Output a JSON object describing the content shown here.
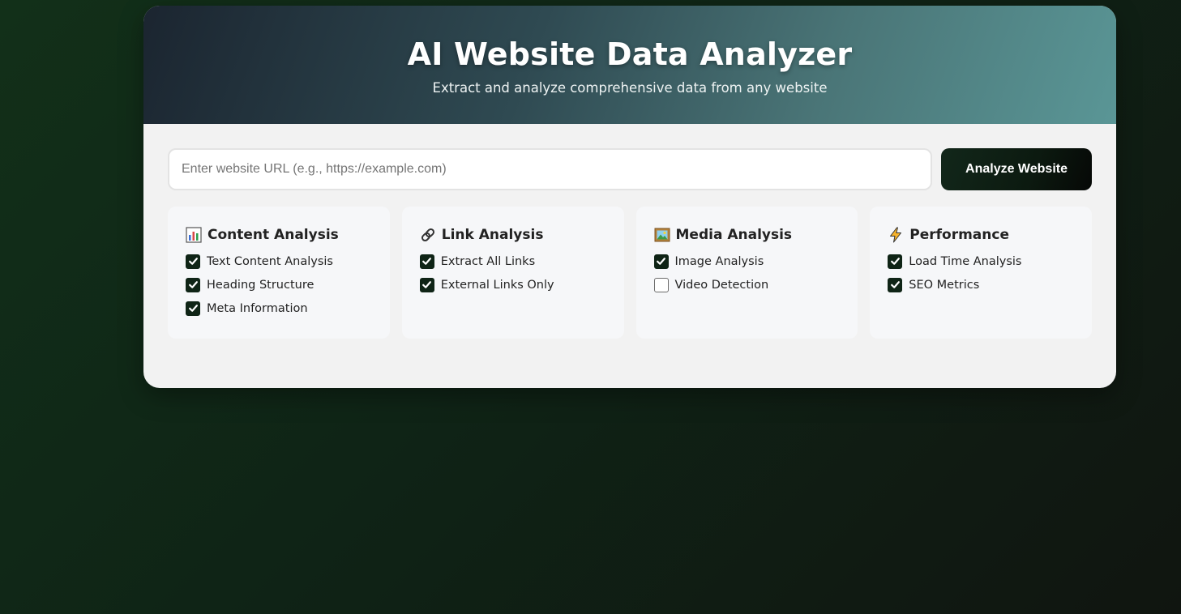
{
  "header": {
    "title": "AI Website Data Analyzer",
    "subtitle": "Extract and analyze comprehensive data from any website"
  },
  "search": {
    "placeholder": "Enter website URL (e.g., https://example.com)",
    "value": "",
    "button_label": "Analyze Website"
  },
  "colors": {
    "accent": "#0f2416",
    "header_start": "#1b2530",
    "header_end": "#5a9696"
  },
  "options": [
    {
      "icon": "bar-chart-icon",
      "title": "Content Analysis",
      "items": [
        {
          "label": "Text Content Analysis",
          "checked": true
        },
        {
          "label": "Heading Structure",
          "checked": true
        },
        {
          "label": "Meta Information",
          "checked": true
        }
      ]
    },
    {
      "icon": "link-icon",
      "title": "Link Analysis",
      "items": [
        {
          "label": "Extract All Links",
          "checked": true
        },
        {
          "label": "External Links Only",
          "checked": true
        }
      ]
    },
    {
      "icon": "framed-picture-icon",
      "title": "Media Analysis",
      "items": [
        {
          "label": "Image Analysis",
          "checked": true
        },
        {
          "label": "Video Detection",
          "checked": false
        }
      ]
    },
    {
      "icon": "lightning-icon",
      "title": "Performance",
      "items": [
        {
          "label": "Load Time Analysis",
          "checked": true
        },
        {
          "label": "SEO Metrics",
          "checked": true
        }
      ]
    }
  ]
}
